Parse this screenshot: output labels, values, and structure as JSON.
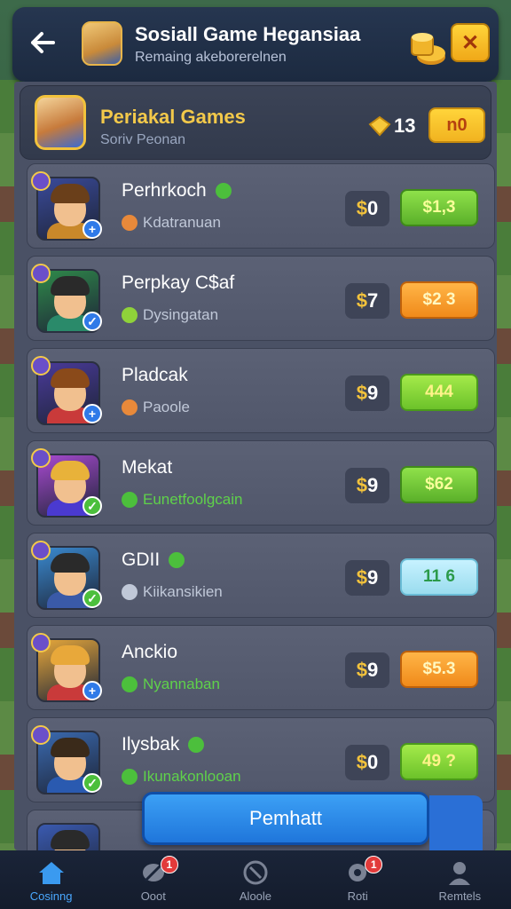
{
  "topbar": {
    "title": "Sosiall Game Hegansiaa",
    "subtitle": "Remaing akeborerelnen",
    "close_label": "✕"
  },
  "header": {
    "title": "Periakal Games",
    "subtitle": "Soriv Peonan",
    "count": "13",
    "button_label": "n0"
  },
  "rows": [
    {
      "name": "Perhrkoch",
      "has_dot": true,
      "sub": "Kdatranuan",
      "sub_color": "#e8893a",
      "price": "0",
      "action": "$1,3",
      "btn": "btn-green",
      "hair": "#6a3f1a",
      "bg": "#3a4a9a",
      "body": "#c9882a",
      "badge": "#2f7ae8",
      "badge_glyph": "+"
    },
    {
      "name": "Perpkay C$af",
      "has_dot": false,
      "sub": "Dysingatan",
      "sub_color": "#8fd23a",
      "price": "7",
      "action": "$2 3",
      "btn": "btn-orange",
      "hair": "#2a2a2a",
      "bg": "#2f8a4a",
      "body": "#2a8a6a",
      "badge": "#2f7ae8",
      "badge_glyph": "✓"
    },
    {
      "name": "Pladcak",
      "has_dot": false,
      "sub": "Paoole",
      "sub_color": "#e8893a",
      "price": "9",
      "action": "444",
      "btn": "btn-lime",
      "hair": "#8a4a1a",
      "bg": "#4a3a9a",
      "body": "#c93a3a",
      "badge": "#2f7ae8",
      "badge_glyph": "+"
    },
    {
      "name": "Mekat",
      "has_dot": false,
      "sub": "Eunetfoolgcain",
      "sub_color": "#4cbf3c",
      "price": "9",
      "action": "$62",
      "btn": "btn-green",
      "hair": "#e8b23a",
      "bg": "#a84ad0",
      "body": "#4a3ad0",
      "badge": "#4cbf3c",
      "badge_glyph": "✓"
    },
    {
      "name": "GDII",
      "has_dot": true,
      "sub": "Kiikansikien",
      "sub_color": "#c0c8d8",
      "price": "9",
      "action": "11 6",
      "btn": "btn-cyan",
      "hair": "#2a2a2a",
      "bg": "#3a8ad0",
      "body": "#3a5aa8",
      "badge": "#4cbf3c",
      "badge_glyph": "✓"
    },
    {
      "name": "Anckio",
      "has_dot": false,
      "sub": "Nyannaban",
      "sub_color": "#4cbf3c",
      "price": "9",
      "action": "$5.3",
      "btn": "btn-orange",
      "hair": "#e8a83a",
      "bg": "#e8a83a",
      "body": "#c93a3a",
      "badge": "#2f7ae8",
      "badge_glyph": "+"
    },
    {
      "name": "Ilysbak",
      "has_dot": true,
      "sub": "Ikunakonlooan",
      "sub_color": "#4cbf3c",
      "price": "0",
      "action": "49 ?",
      "btn": "btn-lime",
      "hair": "#3a2a1a",
      "bg": "#3a6ab0",
      "body": "#2a5ab0",
      "badge": "#4cbf3c",
      "badge_glyph": "✓"
    }
  ],
  "cta": {
    "label": "Pemhatt"
  },
  "nav": [
    {
      "label": "Cosinng",
      "icon": "home-icon",
      "active": true,
      "badge": ""
    },
    {
      "label": "Ooot",
      "icon": "leaf-icon",
      "active": false,
      "badge": "1"
    },
    {
      "label": "Aloole",
      "icon": "compass-icon",
      "active": false,
      "badge": ""
    },
    {
      "label": "Roti",
      "icon": "gear-icon",
      "active": false,
      "badge": "1"
    },
    {
      "label": "Remtels",
      "icon": "person-icon",
      "active": false,
      "badge": ""
    }
  ],
  "colors": {
    "accent": "#f3c94a",
    "primary": "#2f86ea"
  }
}
